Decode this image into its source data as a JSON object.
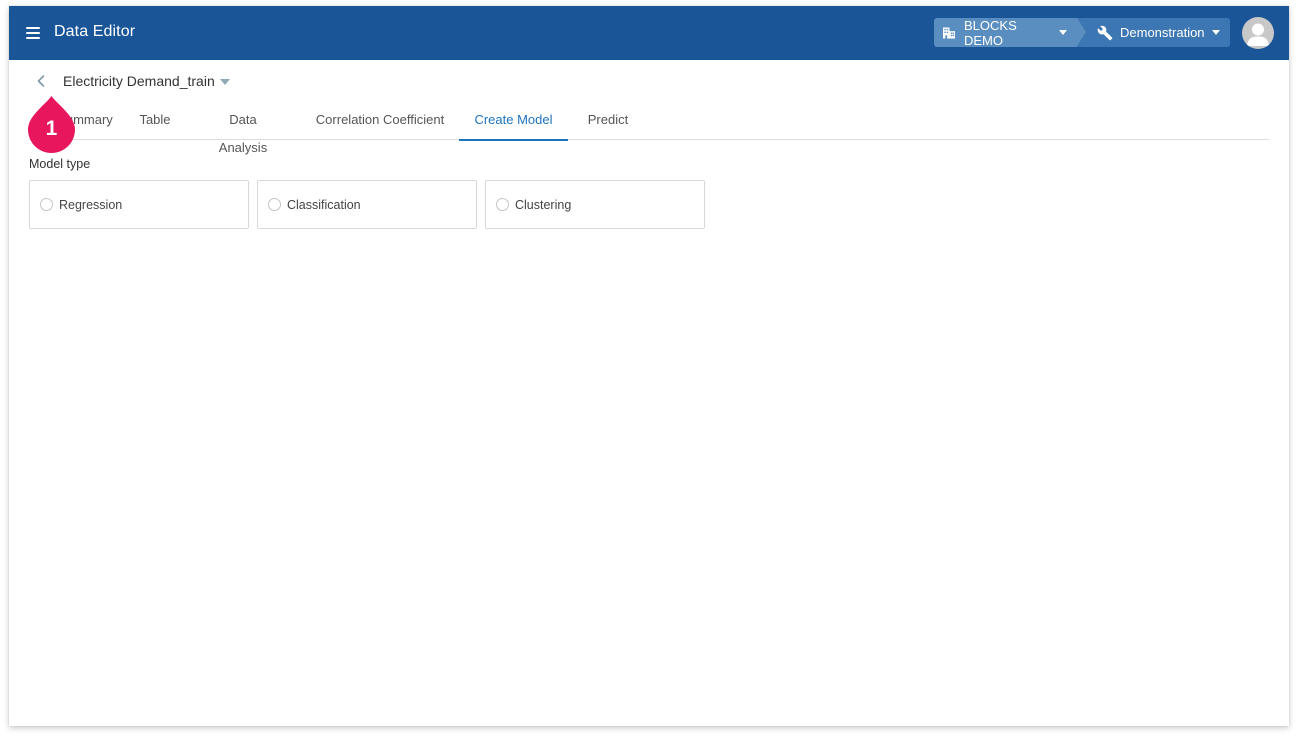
{
  "header": {
    "app_title": "Data Editor",
    "menu_icon": "hamburger-menu-icon",
    "organization": {
      "label": "BLOCKS DEMO",
      "icon": "building-icon"
    },
    "project": {
      "label": "Demonstration",
      "icon": "wrench-icon"
    },
    "avatar_icon": "user-avatar-icon",
    "colors": {
      "bar": "#1a5597",
      "org_button": "#5a8ec0",
      "project_button": "#3d77b3"
    }
  },
  "dataset": {
    "back_icon": "chevron-left-icon",
    "name": "Electricity Demand_train",
    "dropdown_icon": "caret-down-icon"
  },
  "tabs": [
    {
      "label": "Summary",
      "active": false
    },
    {
      "label": "Table",
      "active": false
    },
    {
      "label": "Data Analysis",
      "active": false
    },
    {
      "label": "Correlation Coefficient",
      "active": false
    },
    {
      "label": "Create Model",
      "active": true
    },
    {
      "label": "Predict",
      "active": false
    }
  ],
  "tab_active_color": "#1e73be",
  "model_type": {
    "label": "Model type",
    "options": [
      {
        "label": "Regression",
        "selected": false
      },
      {
        "label": "Classification",
        "selected": false
      },
      {
        "label": "Clustering",
        "selected": false
      }
    ]
  },
  "annotation": {
    "number": "1",
    "color": "#e8175d"
  }
}
